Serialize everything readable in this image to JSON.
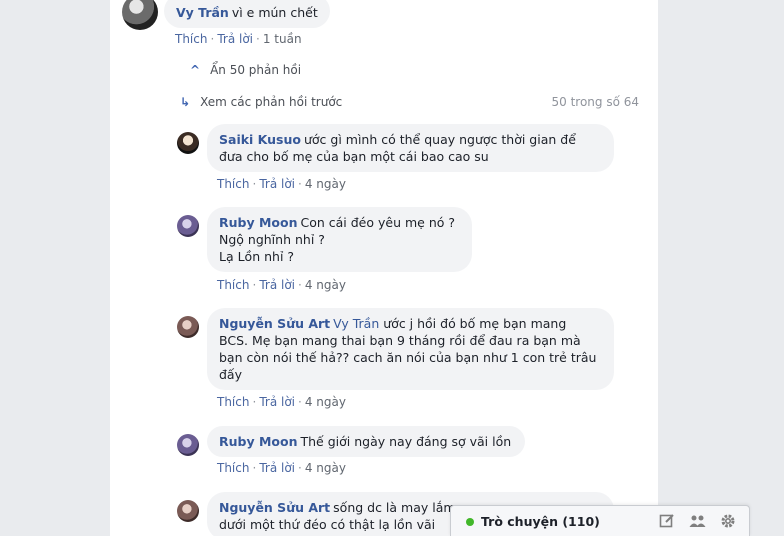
{
  "top_comment": {
    "author": "Vy Trần",
    "text": "vì e mún chết",
    "like": "Thích",
    "reply": "Trả lời",
    "time": "1 tuần"
  },
  "replies_toggle": {
    "hide_label": "Ẩn 50 phản hồi",
    "prev_label": "Xem các phản hồi trước",
    "count": "50 trong số 64"
  },
  "replies": [
    {
      "author": "Saiki Kusuo",
      "mention": "",
      "line1": "ước gì mình có thể quay ngược thời gian để",
      "lines": [
        "đưa cho bố mẹ của bạn một cái bao cao su"
      ],
      "like": "Thích",
      "reply": "Trả lời",
      "time": "4 ngày"
    },
    {
      "author": "Ruby Moon",
      "mention": "",
      "line1": "Con cái đéo yêu mẹ nó ?",
      "lines": [
        "Ngộ nghĩnh nhỉ ?",
        "Lạ Lồn nhỉ ?"
      ],
      "like": "Thích",
      "reply": "Trả lời",
      "time": "4 ngày"
    },
    {
      "author": "Nguyễn Sửu Art",
      "mention": "Vy Trần",
      "line1": "ước j hồi đó bố mẹ bạn mang",
      "lines": [
        "BCS. Mẹ bạn mang thai bạn 9 tháng rồi để đau ra bạn mà",
        "bạn còn nói thế hả?? cach ăn nói của bạn như 1 con trẻ trâu",
        "đấy"
      ],
      "like": "Thích",
      "reply": "Trả lời",
      "time": "4 ngày"
    },
    {
      "author": "Ruby Moon",
      "mention": "",
      "line1": "Thế giới ngày nay đáng sợ vãi lồn",
      "lines": [],
      "like": "Thích",
      "reply": "Trả lời",
      "time": "4 ngày"
    },
    {
      "author": "Nguyễn Sửu Art",
      "mention": "",
      "line1": "sống dc là may lắm...",
      "lines": [
        "dưới một thứ đéo có thật lạ lồn vãi"
      ],
      "like": "",
      "reply": "",
      "time": ""
    }
  ],
  "chat": {
    "label": "Trò chuyện (110)",
    "status_color": "#42b72a"
  },
  "icons": [
    "chevron-up-icon",
    "reply-arrow-icon",
    "compose-icon",
    "contacts-icon",
    "gear-icon"
  ]
}
